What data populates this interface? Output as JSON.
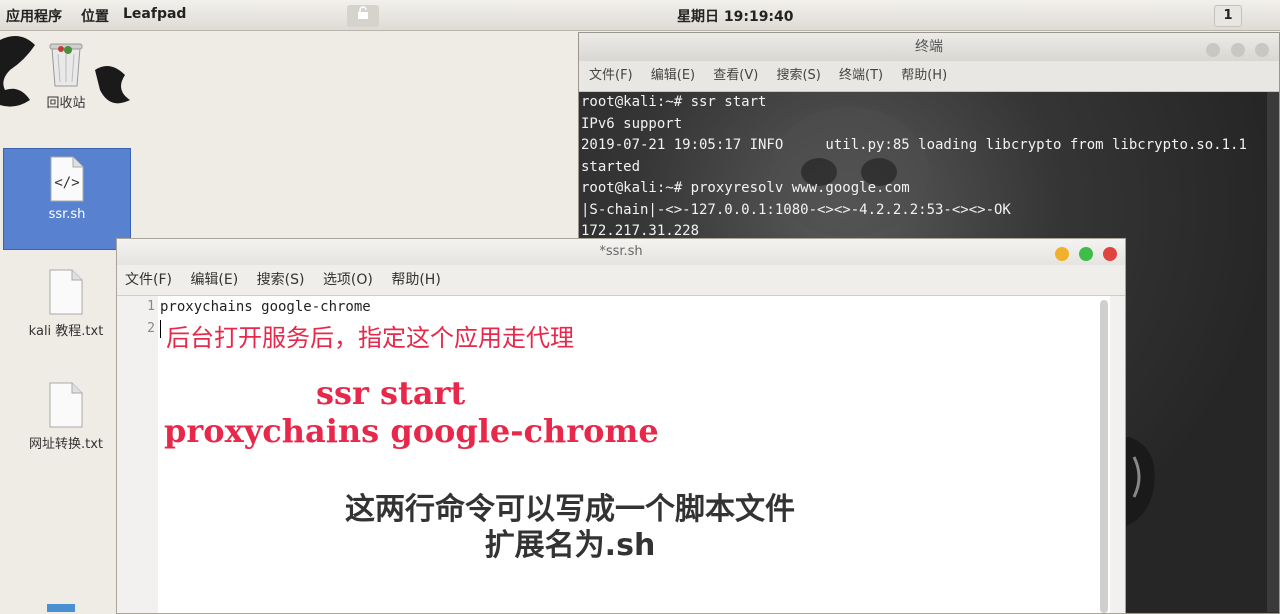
{
  "top_panel": {
    "apps_menu": "应用程序",
    "places_menu": "位置",
    "active_app": "Leafpad",
    "clock": "星期日 19:19:40",
    "workspace": "1"
  },
  "desktop_icons": [
    {
      "label": "回收站",
      "icon": "trash-icon"
    },
    {
      "label": "ssr.sh",
      "icon": "script-file-icon"
    },
    {
      "label": "kali 教程.txt",
      "icon": "text-file-icon"
    },
    {
      "label": "网址转换.txt",
      "icon": "text-file-icon"
    }
  ],
  "terminal": {
    "title": "终端",
    "menu": [
      "文件(F)",
      "编辑(E)",
      "查看(V)",
      "搜索(S)",
      "终端(T)",
      "帮助(H)"
    ],
    "lines": [
      "root@kali:~# ssr start",
      "IPv6 support",
      "2019-07-21 19:05:17 INFO     util.py:85 loading libcrypto from libcrypto.so.1.1",
      "started",
      "root@kali:~# proxyresolv www.google.com",
      "|S-chain|-<>-127.0.0.1:1080-<><>-4.2.2.2:53-<><>-OK",
      "172.217.31.228"
    ]
  },
  "editor": {
    "title": "*ssr.sh",
    "menu": [
      "文件(F)",
      "编辑(E)",
      "搜索(S)",
      "选项(O)",
      "帮助(H)"
    ],
    "line_numbers": [
      "1",
      "2"
    ],
    "code": [
      "proxychains google-chrome",
      ""
    ],
    "annotation_red": "后台打开服务后，指定这个应用走代理",
    "annotation_cmd1": "ssr start",
    "annotation_cmd2": "proxychains google-chrome",
    "annotation_black1": "这两行命令可以写成一个脚本文件",
    "annotation_black2": "扩展名为.sh"
  },
  "colors": {
    "annotation_red": "#e8284a",
    "selection_blue": "#5882d0",
    "btn_close": "#e0443e",
    "btn_min": "#f2b12c",
    "btn_max": "#3ebd49"
  }
}
